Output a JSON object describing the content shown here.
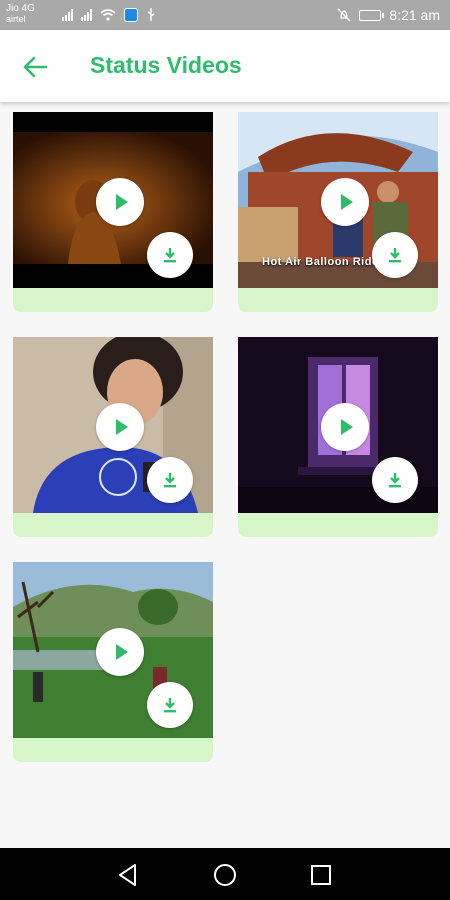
{
  "status_bar": {
    "carrier1": "Jio 4G",
    "carrier2": "airtel",
    "time": "8:21 am"
  },
  "app_bar": {
    "title": "Status Videos",
    "back_icon": "arrow-back-icon"
  },
  "videos": [
    {
      "thumb": "dark-amber-figure",
      "overlay": ""
    },
    {
      "thumb": "hot-air-balloon",
      "overlay": "Hot Air Balloon Ride"
    },
    {
      "thumb": "girl-blue-shirt",
      "overlay": ""
    },
    {
      "thumb": "purple-window",
      "overlay": ""
    },
    {
      "thumb": "green-field",
      "overlay": ""
    }
  ],
  "icons": {
    "play": "play-icon",
    "download": "download-icon"
  },
  "colors": {
    "accent": "#2ebd6b",
    "card_footer": "#d6f5c8"
  },
  "nav": [
    "back-nav-icon",
    "home-nav-icon",
    "recents-nav-icon"
  ]
}
